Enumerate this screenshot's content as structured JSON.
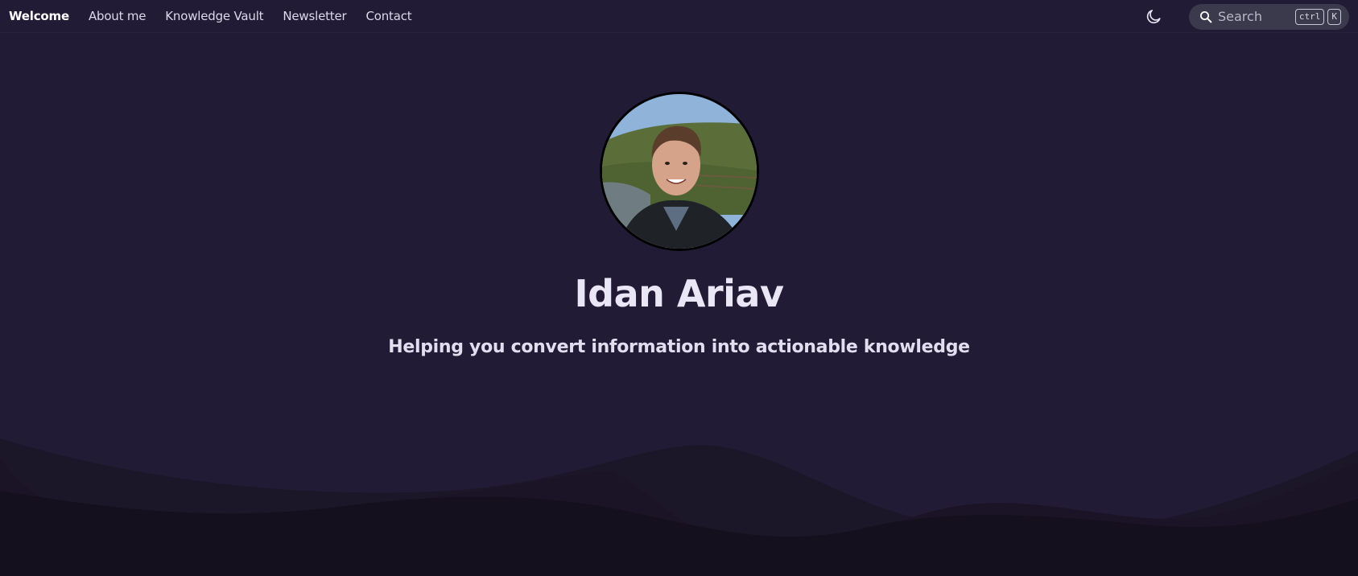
{
  "nav": {
    "items": [
      {
        "label": "Welcome",
        "active": true
      },
      {
        "label": "About me",
        "active": false
      },
      {
        "label": "Knowledge Vault",
        "active": false
      },
      {
        "label": "Newsletter",
        "active": false
      },
      {
        "label": "Contact",
        "active": false
      }
    ],
    "theme_toggle_icon": "moon-icon",
    "search": {
      "placeholder": "Search",
      "icon": "search-icon",
      "shortcut_keys": [
        "ctrl",
        "K"
      ]
    }
  },
  "hero": {
    "avatar_icon": "profile-photo",
    "title": "Idan Ariav",
    "subtitle": "Helping you convert information into actionable knowledge"
  },
  "colors": {
    "background": "#221b35",
    "wave_layer_1": "#1d172d",
    "wave_layer_2": "#18131f",
    "text_primary": "#e9e7f6",
    "search_bg": "#3b3a4c"
  }
}
